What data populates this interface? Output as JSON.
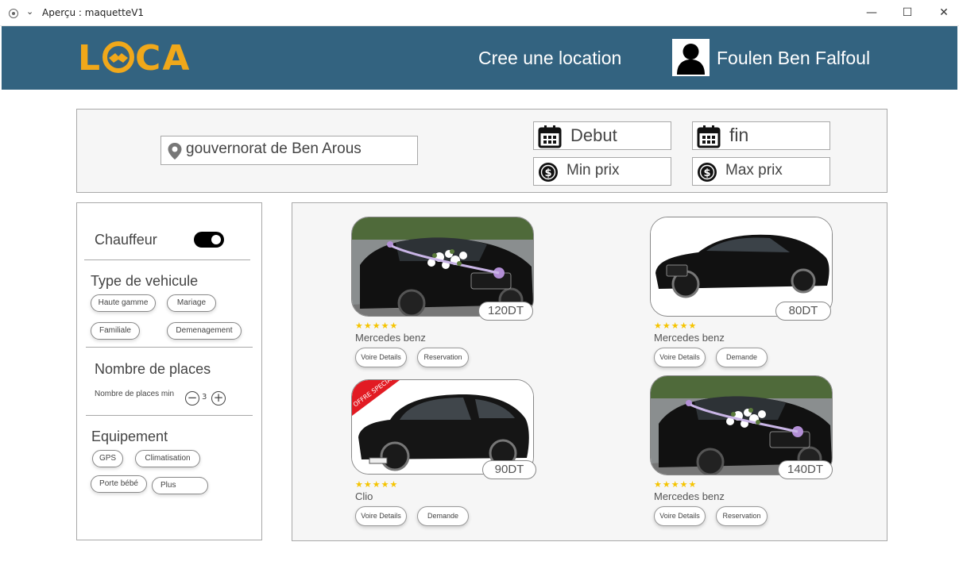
{
  "window": {
    "title": "Aperçu : maquetteV1",
    "minimize": "—",
    "maximize": "☐",
    "close": "✕"
  },
  "header": {
    "logo_start": "L",
    "logo_end": "CA",
    "create_link": "Cree une location",
    "user_name": "Foulen Ben Falfoul"
  },
  "search": {
    "location": "gouvernorat de Ben Arous",
    "start": "Debut",
    "end": "fin",
    "min_price": "Min prix",
    "max_price": "Max prix"
  },
  "filters": {
    "chauffeur_label": "Chauffeur",
    "chauffeur_on": true,
    "vehicle_type_title": "Type de vehicule",
    "vehicle_types": [
      "Haute gamme",
      "Mariage",
      "Familiale",
      "Demenagement"
    ],
    "places_title": "Nombre de places",
    "places_min_label": "Nombre de places min",
    "places_min_value": "3",
    "equipment_title": "Equipement",
    "equipment": [
      "GPS",
      "Climatisation",
      "Porte bébé",
      "Plus"
    ]
  },
  "cars": [
    {
      "name": "Mercedes benz",
      "price": "120DT",
      "rating": 5,
      "btn1": "Voire Details",
      "btn2": "Reservation"
    },
    {
      "name": "Mercedes benz",
      "price": "80DT",
      "rating": 5,
      "btn1": "Voire Details",
      "btn2": "Demande"
    },
    {
      "name": "Clio",
      "price": "90DT",
      "rating": 5,
      "btn1": "Voire Details",
      "btn2": "Demande",
      "badge": "OFFRE SPECIAL"
    },
    {
      "name": "Mercedes benz",
      "price": "140DT",
      "rating": 5,
      "btn1": "Voire Details",
      "btn2": "Reservation"
    }
  ],
  "colors": {
    "header": "#336380",
    "logo": "#f0a81a",
    "star": "#f5c400"
  }
}
